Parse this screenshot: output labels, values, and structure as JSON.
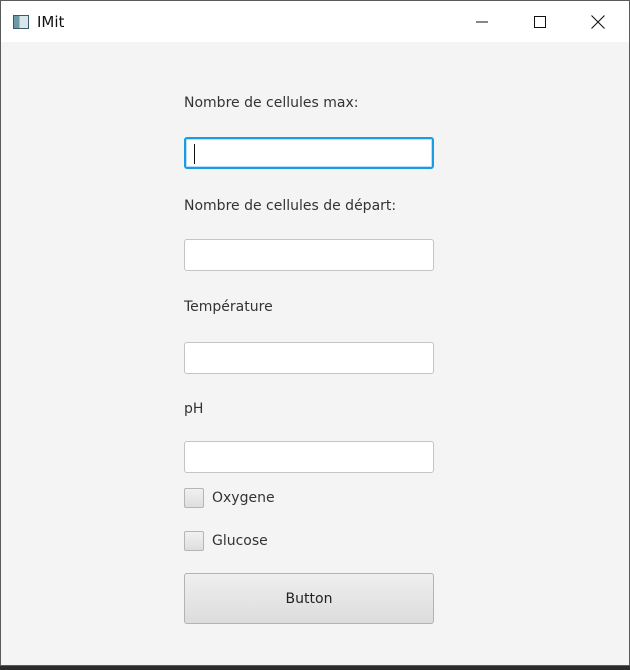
{
  "window": {
    "title": "IMit",
    "icons": {
      "app": "app-window-icon",
      "minimize": "minimize-icon",
      "maximize": "maximize-icon",
      "close": "close-icon"
    }
  },
  "form": {
    "fields": [
      {
        "label": "Nombre de cellules max:",
        "value": "",
        "focused": true
      },
      {
        "label": "Nombre de cellules de départ:",
        "value": ""
      },
      {
        "label": "Température",
        "value": ""
      },
      {
        "label": "pH",
        "value": ""
      }
    ],
    "checkboxes": [
      {
        "label": "Oxygene",
        "checked": false
      },
      {
        "label": "Glucose",
        "checked": false
      }
    ],
    "button_label": "Button"
  },
  "colors": {
    "focus_border": "#1a9be6",
    "background": "#f4f4f4"
  }
}
